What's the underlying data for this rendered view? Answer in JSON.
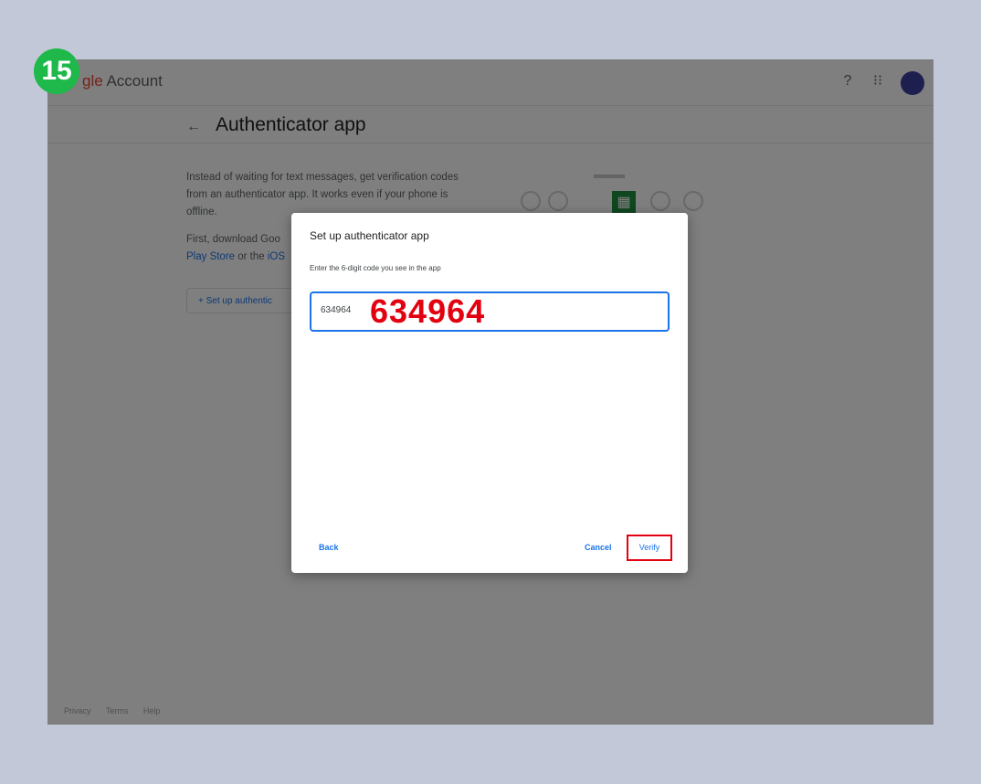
{
  "step_badge": "15",
  "app": {
    "brand_prefix": "gle",
    "brand_suffix": " Account",
    "icons": [
      "help-icon",
      "apps-grid-icon"
    ]
  },
  "page": {
    "title": "Authenticator app",
    "description": "Instead of waiting for text messages, get verification codes from an authenticator app. It works even if your phone is offline.",
    "download_text": "First, download Goo",
    "play_store_link": "Play Store",
    "or_the": " or the ",
    "ios_link": "iOS",
    "setup_button": "+ Set up authentic"
  },
  "footer": [
    "Privacy",
    "Terms",
    "Help"
  ],
  "dialog": {
    "title": "Set up authenticator app",
    "instruction": "Enter the 6-digit code you see in the app",
    "code_value": "634964",
    "code_annotation": "634964",
    "back_label": "Back",
    "cancel_label": "Cancel",
    "verify_label": "Verify"
  },
  "colors": {
    "accent": "#1a73e8",
    "annotation_red": "#e3000f",
    "badge_green": "#1fb84a"
  }
}
